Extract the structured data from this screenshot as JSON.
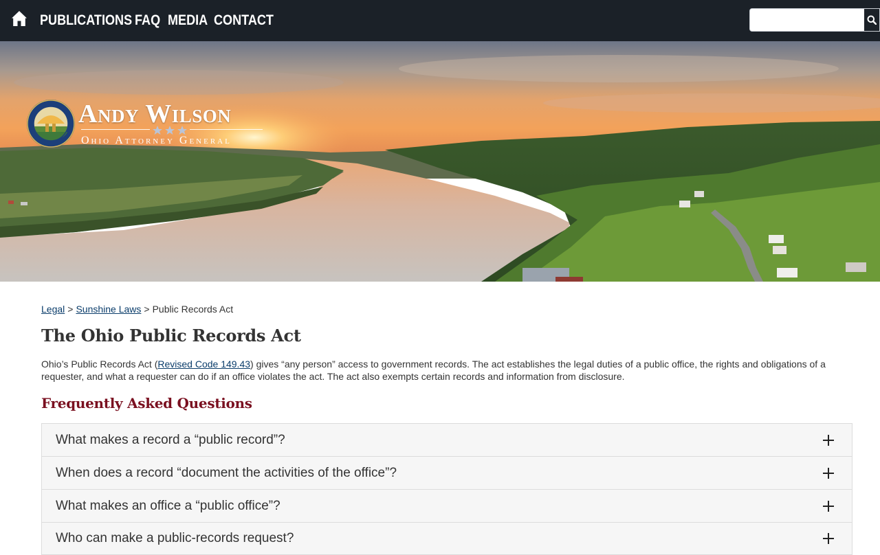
{
  "nav": {
    "items": [
      "PUBLICATIONS",
      "FAQ",
      "MEDIA",
      "CONTACT"
    ],
    "icons": {
      "home": "home-icon",
      "search": "search-icon"
    }
  },
  "search": {
    "placeholder": "",
    "value": ""
  },
  "brand": {
    "name": "Andy Wilson",
    "subtitle": "Ohio Attorney General",
    "seal_text": "ATTORNEY GENERAL OF THE STATE OF OHIO • THE SEAL OF THE •"
  },
  "breadcrumb": {
    "items": [
      "Legal",
      "Sunshine Laws"
    ],
    "current": "Public Records Act",
    "separator": ">"
  },
  "page": {
    "title": "The Ohio Public Records Act",
    "intro_before": "Ohio’s Public Records Act (",
    "intro_link": "Revised Code 149.43",
    "intro_after": ") gives “any person” access to government records. The act establishes the legal duties of a public office, the rights and obligations of a requester, and what a requester can do if an office violates the act. The act also exempts certain records and information from disclosure.",
    "faq_heading": "Frequently Asked Questions"
  },
  "faq": [
    "What makes a record a “public record”?",
    "When does a record “document the activities of the office”?",
    "What makes an office a “public office”?",
    "Who can make a public-records request?"
  ],
  "colors": {
    "nav_bg": "#1b2128",
    "heading_accent": "#7a1020",
    "link": "#0b3d6b",
    "accordion_bg": "#f6f6f6"
  }
}
